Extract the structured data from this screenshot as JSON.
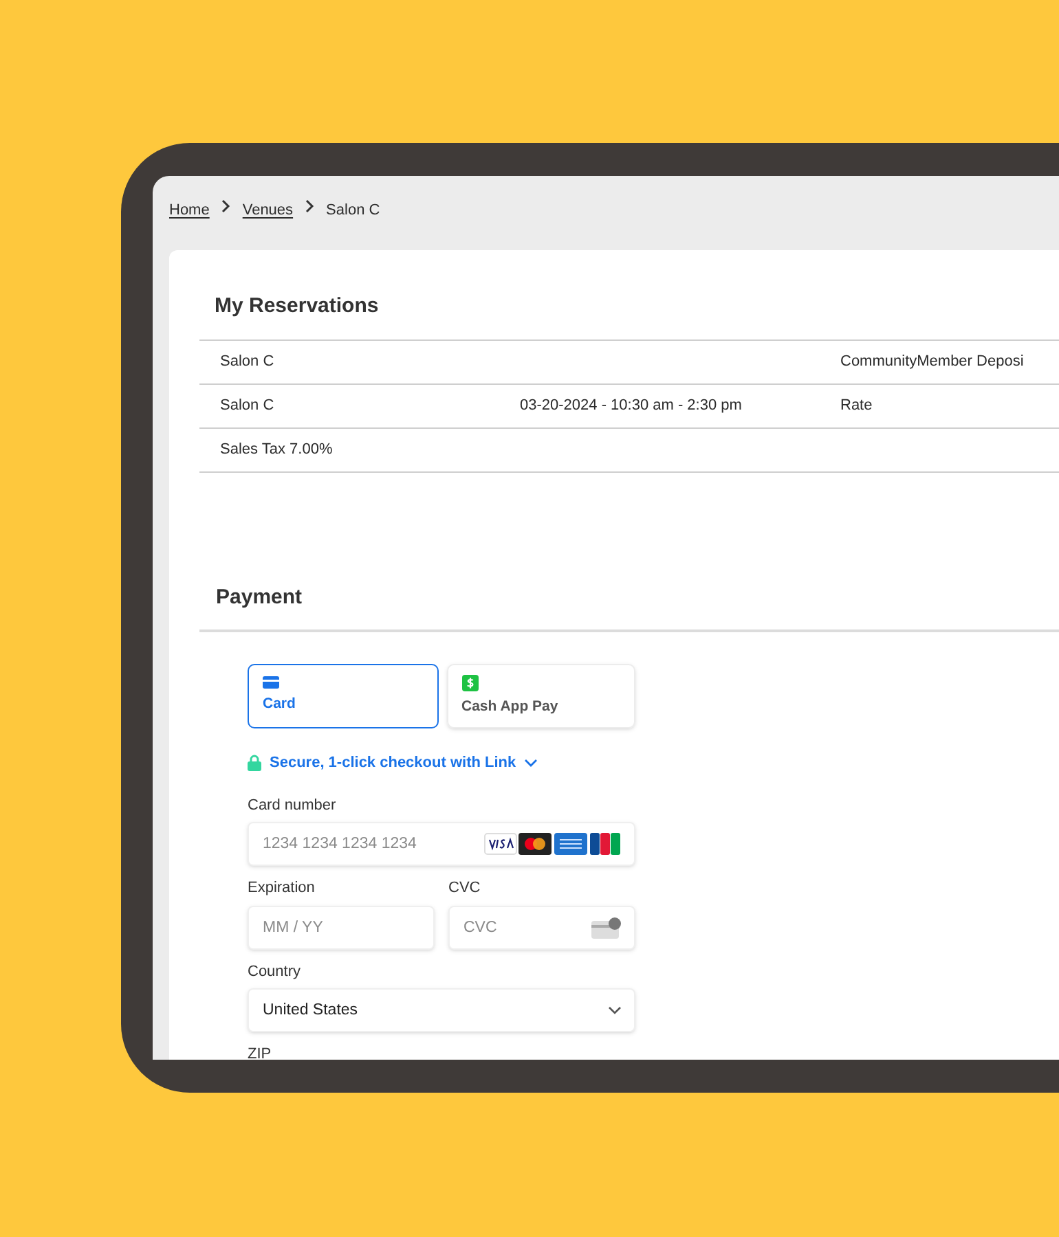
{
  "breadcrumb": [
    {
      "label": "Home",
      "link": true
    },
    {
      "label": "Venues",
      "link": true
    },
    {
      "label": "Salon C",
      "link": false
    }
  ],
  "reservations": {
    "title": "My Reservations",
    "rows": [
      {
        "cells": [
          "Salon C",
          "",
          "CommunityMember Deposi"
        ]
      },
      {
        "cells": [
          "Salon C",
          "03-20-2024 - 10:30 am - 2:30 pm",
          "Rate"
        ]
      },
      {
        "cells": [
          "Sales Tax 7.00%",
          "",
          ""
        ]
      }
    ]
  },
  "payment": {
    "title": "Payment",
    "methods": [
      {
        "kind": "card",
        "label": "Card",
        "selected": true
      },
      {
        "kind": "cashapp",
        "label": "Cash App Pay",
        "selected": false
      }
    ],
    "link": {
      "label": "Secure, 1-click checkout with Link"
    },
    "fields": [
      {
        "kind": "card",
        "label": "Card number",
        "placeholder": "1234 1234 1234 1234"
      },
      {
        "kind": "expiry",
        "label": "Expiration",
        "placeholder": "MM / YY"
      },
      {
        "kind": "cvc",
        "label": "CVC",
        "placeholder": "CVC"
      },
      {
        "kind": "select",
        "label": "Country",
        "value": "United States"
      },
      {
        "kind": "text",
        "label": "ZIP"
      }
    ]
  }
}
